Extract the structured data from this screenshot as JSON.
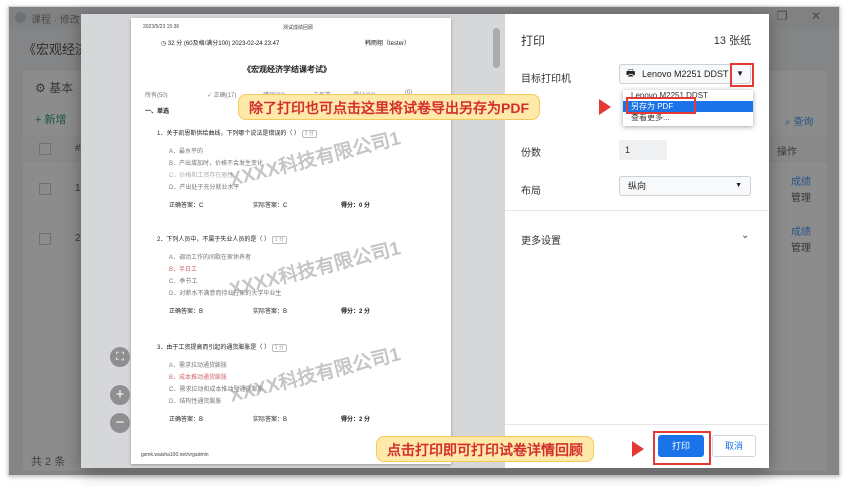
{
  "app": {
    "window_title": "课程 · 修改",
    "breadcrumb": "《宏观经济",
    "tab_label": "基本",
    "add_label": "+ 新增",
    "col_index": "#",
    "col_ops": "操作",
    "search_label": "查询",
    "rows": [
      {
        "index": "1",
        "score_link": "成绩",
        "manage_link": "管理"
      },
      {
        "index": "2",
        "score_link": "成绩",
        "manage_link": "管理"
      }
    ],
    "footer_total": "共 2 条"
  },
  "paper": {
    "print_time": "2023/5/23 15:36",
    "doc_label": "测试成绩回顾",
    "score_line": "32 分 (60及格/满分100) 2023-02-24 23:47",
    "student": "韩雨翔（tester）",
    "title": "《宏观经济学结课考试》",
    "filter_all": "所有(50)",
    "filter_correct": "正确(17)",
    "filter_c3": "错误(33)",
    "filter_c4": "未作答",
    "filter_c5": "得分(32)",
    "filter_c6": "(0)",
    "section": "一、单选",
    "tag": "1 分",
    "questions": [
      {
        "stem": "1．关于凯恩斯供给曲线，下列哪个说法是错误的（ ）",
        "options": [
          "A．最水平的",
          "B．产出增加时，价格不会发生变化",
          "C．价格和工资存在刚性",
          "D．产出处于充分就业水平"
        ],
        "correct": "正确答案：C",
        "actual": "实际答案：C",
        "score": "得分：0 分"
      },
      {
        "stem": "2．下列人员中，不属于失业人员的是（ ）",
        "options": [
          "A．调动工作的间歇在家休养者",
          "B．半日工",
          "C．季节工",
          "D．对薪水不满意而待业在家的大学毕业生"
        ],
        "correct": "正确答案：B",
        "actual": "实际答案：B",
        "score": "得分：2 分"
      },
      {
        "stem": "3．由于工资提高而引起的通货膨胀是（ ）",
        "options": [
          "A．需求拉动通货膨胀",
          "B．成本推动通货膨胀",
          "C．需求拉动和成本推动型通货膨胀",
          "D．结构性通货膨胀"
        ],
        "correct": "正确答案：B",
        "actual": "实际答案：B",
        "score": "得分：2 分"
      }
    ],
    "footer_url": "gsmk.waisha100.net/vrgadmin",
    "watermark": "XXXX科技有限公司1"
  },
  "print": {
    "title": "打印",
    "sheets": "13 张纸",
    "printer_label": "目标打印机",
    "printer_value": "Lenovo M2251 DDST",
    "dropdown_items": [
      "Lenovo M2251 DDST",
      "另存为 PDF",
      "查看更多..."
    ],
    "copies_label": "份数",
    "copies_value": "1",
    "layout_label": "布局",
    "layout_value": "纵向",
    "more_settings": "更多设置",
    "print_button": "打印",
    "cancel_button": "取消"
  },
  "annotations": {
    "callout_top": "除了打印也可点击这里将试卷导出另存为PDF",
    "callout_bottom": "点击打印即可打印试卷详情回顾"
  },
  "colors": {
    "accent": "#1a73e8",
    "annotation_red": "#e53935",
    "callout_bg": "#ffe9a8"
  },
  "icons": [
    "printer-icon",
    "chevron-down-icon",
    "zoom-in-icon",
    "zoom-out-icon",
    "fit-page-icon",
    "clock-icon",
    "search-icon",
    "check-icon"
  ]
}
